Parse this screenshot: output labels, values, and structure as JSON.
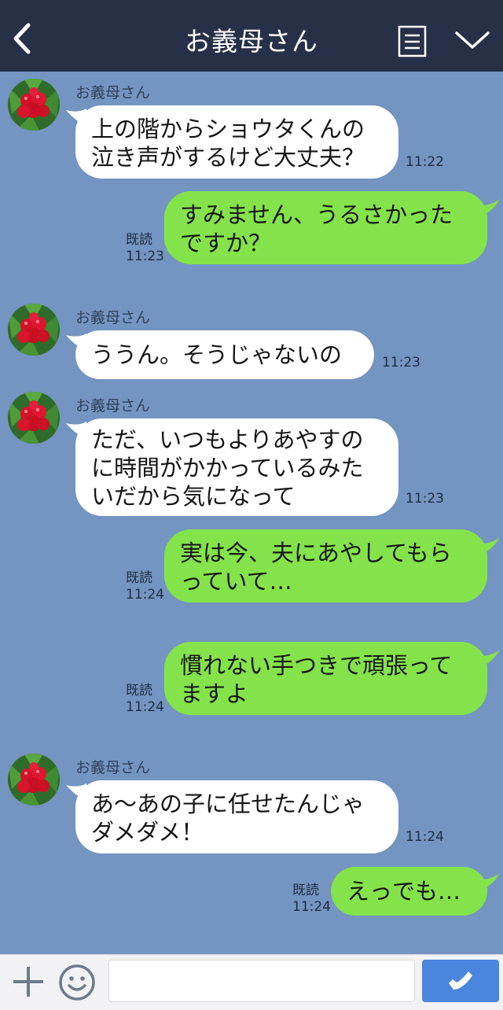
{
  "header": {
    "title": "お義母さん",
    "back_icon": "chevron-left-icon",
    "menu_icon": "menu-icon",
    "collapse_icon": "chevron-down-icon",
    "background": "#263147"
  },
  "chat": {
    "background": "#7494c1",
    "incoming_bubble_color": "#ffffff",
    "outgoing_bubble_color": "#84e34b",
    "messages": [
      {
        "direction": "in",
        "sender": "お義母さん",
        "text": "上の階からショウタくんの\n泣き声がするけど大丈夫？",
        "time": "11:22"
      },
      {
        "direction": "out",
        "read": "既読",
        "text": "すみません、うるさかった\nですか？",
        "time": "11:23"
      },
      {
        "direction": "in",
        "sender": "お義母さん",
        "text": "ううん。そうじゃないの",
        "time": "11:23"
      },
      {
        "direction": "in",
        "sender": "お義母さん",
        "text": "ただ、いつもよりあやすの\nに時間がかかっているみた\nいだから気になって",
        "time": "11:23"
      },
      {
        "direction": "out",
        "read": "既読",
        "text": "実は今、夫にあやしてもら\nっていて…",
        "time": "11:24"
      },
      {
        "direction": "out",
        "read": "既読",
        "text": "慣れない手つきで頑張って\nますよ",
        "time": "11:24"
      },
      {
        "direction": "in",
        "sender": "お義母さん",
        "text": "あ〜あの子に任せたんじゃ\nダメダメ！",
        "time": "11:24"
      },
      {
        "direction": "out",
        "read": "既読",
        "text": "えっでも…",
        "time": "11:24"
      }
    ]
  },
  "footer": {
    "add_icon": "plus-icon",
    "emoji_icon": "smiley-icon",
    "input_value": "",
    "call_icon": "phone-icon",
    "call_button_color": "#4a86de"
  }
}
